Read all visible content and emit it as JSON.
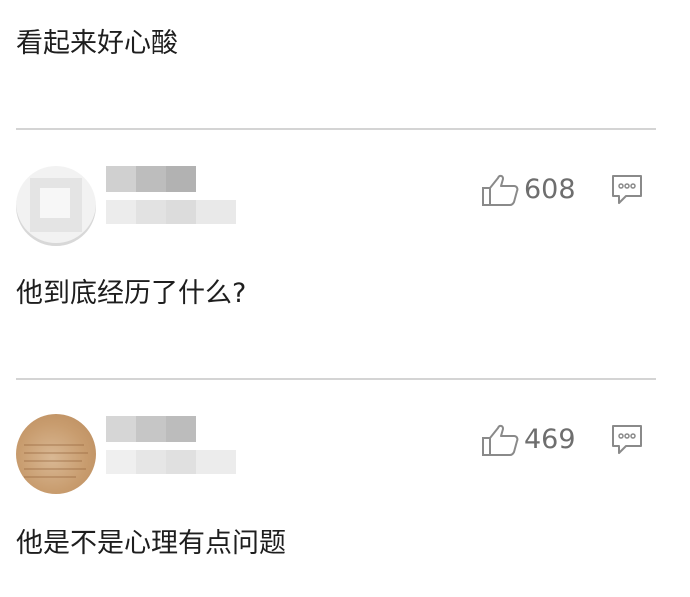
{
  "comments": [
    {
      "text": "看起来好心酸"
    },
    {
      "likes": "608",
      "text": "他到底经历了什么?"
    },
    {
      "likes": "469",
      "text": "他是不是心理有点问题"
    }
  ],
  "icons": {
    "like": "thumbs-up-outline-icon",
    "reply": "speech-bubble-dots-icon"
  },
  "colors": {
    "text": "#1e1e1e",
    "meta": "#6e6e6e",
    "divider": "#d4d4d4"
  }
}
